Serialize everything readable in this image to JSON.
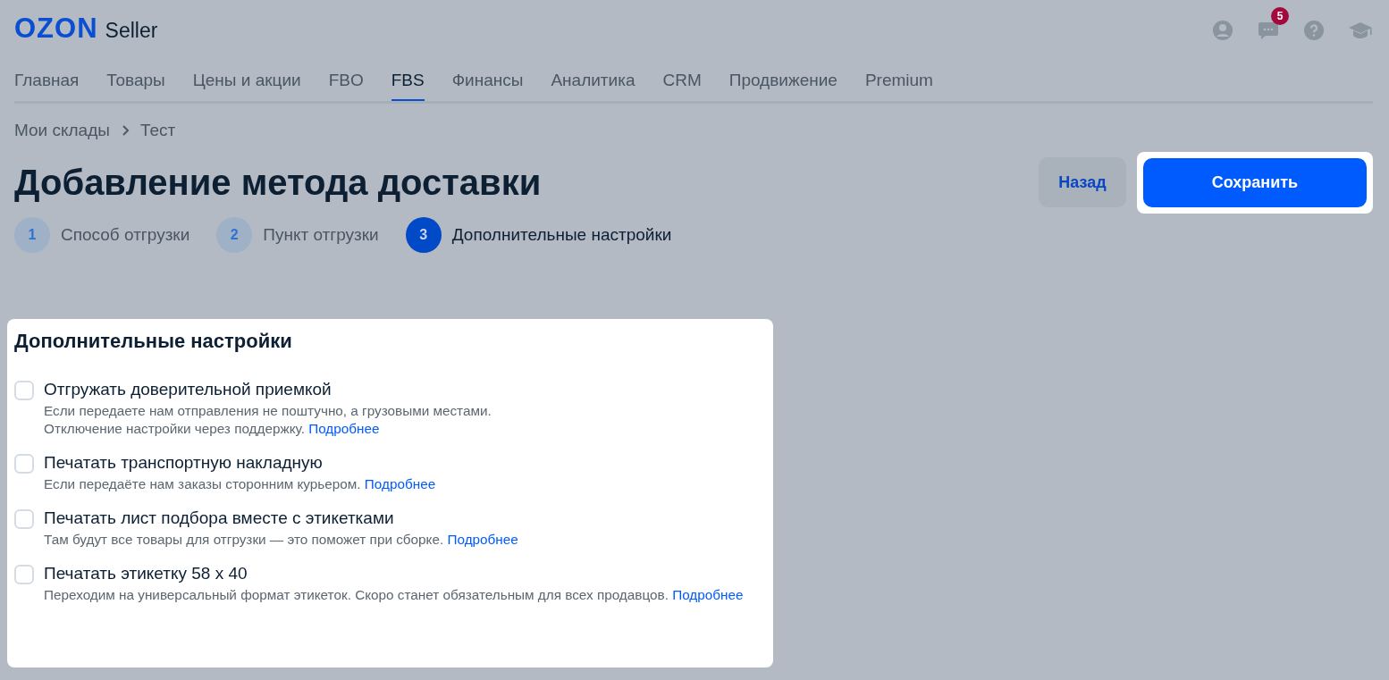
{
  "header": {
    "logo": "OZON",
    "product": "Seller",
    "notifications_badge": "5"
  },
  "nav": [
    {
      "label": "Главная",
      "selected": false
    },
    {
      "label": "Товары",
      "selected": false
    },
    {
      "label": "Цены и акции",
      "selected": false
    },
    {
      "label": "FBO",
      "selected": false
    },
    {
      "label": "FBS",
      "selected": true
    },
    {
      "label": "Финансы",
      "selected": false
    },
    {
      "label": "Аналитика",
      "selected": false
    },
    {
      "label": "CRM",
      "selected": false
    },
    {
      "label": "Продвижение",
      "selected": false
    },
    {
      "label": "Premium",
      "selected": false
    }
  ],
  "breadcrumbs": [
    "Мои склады",
    "Тест"
  ],
  "title": "Добавление метода доставки",
  "buttons": {
    "back": "Назад",
    "save": "Сохранить"
  },
  "steps": [
    {
      "number": "1",
      "label": "Способ отгрузки",
      "selected": false
    },
    {
      "number": "2",
      "label": "Пункт отгрузки",
      "selected": false
    },
    {
      "number": "3",
      "label": "Дополнительные настройки",
      "selected": true
    }
  ],
  "settings": {
    "title": "Дополнительные настройки",
    "options": [
      {
        "label": "Отгружать доверительной приемкой",
        "checked": false,
        "description": [
          "Если передаете нам отправления не поштучно, а грузовыми местами.",
          "Отключение настройки через поддержку."
        ],
        "link": "Подробнее"
      },
      {
        "label": "Печатать транспортную накладную",
        "checked": false,
        "description": [
          "Если передаёте нам заказы сторонним курьером."
        ],
        "link": "Подробнее"
      },
      {
        "label": "Печатать лист подбора вместе с этикетками",
        "checked": false,
        "description": [
          "Там будут все товары для отгрузки — это поможет при сборке."
        ],
        "link": "Подробнее"
      },
      {
        "label": "Печатать этикетку 58 х 40",
        "checked": false,
        "description": [
          "Переходим на универсальный формат этикеток. Скоро станет обязательным для всех продавцов."
        ],
        "link": "Подробнее"
      }
    ]
  }
}
